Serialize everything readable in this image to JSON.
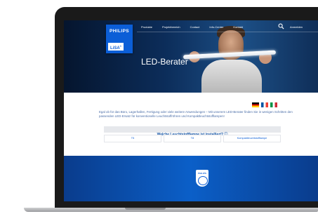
{
  "brand": {
    "name": "PHILIPS",
    "product": "LiSA",
    "mark": "®"
  },
  "nav": {
    "items": [
      "Produkte",
      "Projektbereich",
      "Contact",
      "Info-Center",
      "Kontakt"
    ],
    "login": "Anmelden"
  },
  "hero": {
    "title": "LED-Berater"
  },
  "intro": {
    "text": "Egal ob für das Büro, Lagerhallen, Fertigung oder viele weitere Anwendungen – Mit unserem LED-Berater finden Sie in wenigen Schritten den passenden LED-Ersatz für konventionelle Leuchtstoffröhren und Kompaktleuchtstofflampen!"
  },
  "question": {
    "label": "Welche Leuchtstofflampe ist installiert? ⓘ"
  },
  "options": [
    "T5",
    "T8",
    "Kompaktleuchtstofflampe"
  ],
  "footer": {
    "badge": "PHILIPS"
  },
  "colors": {
    "accent": "#0b5ed7",
    "question_text": "#0b4ea2",
    "hero_bg": "#0c2d5a"
  }
}
